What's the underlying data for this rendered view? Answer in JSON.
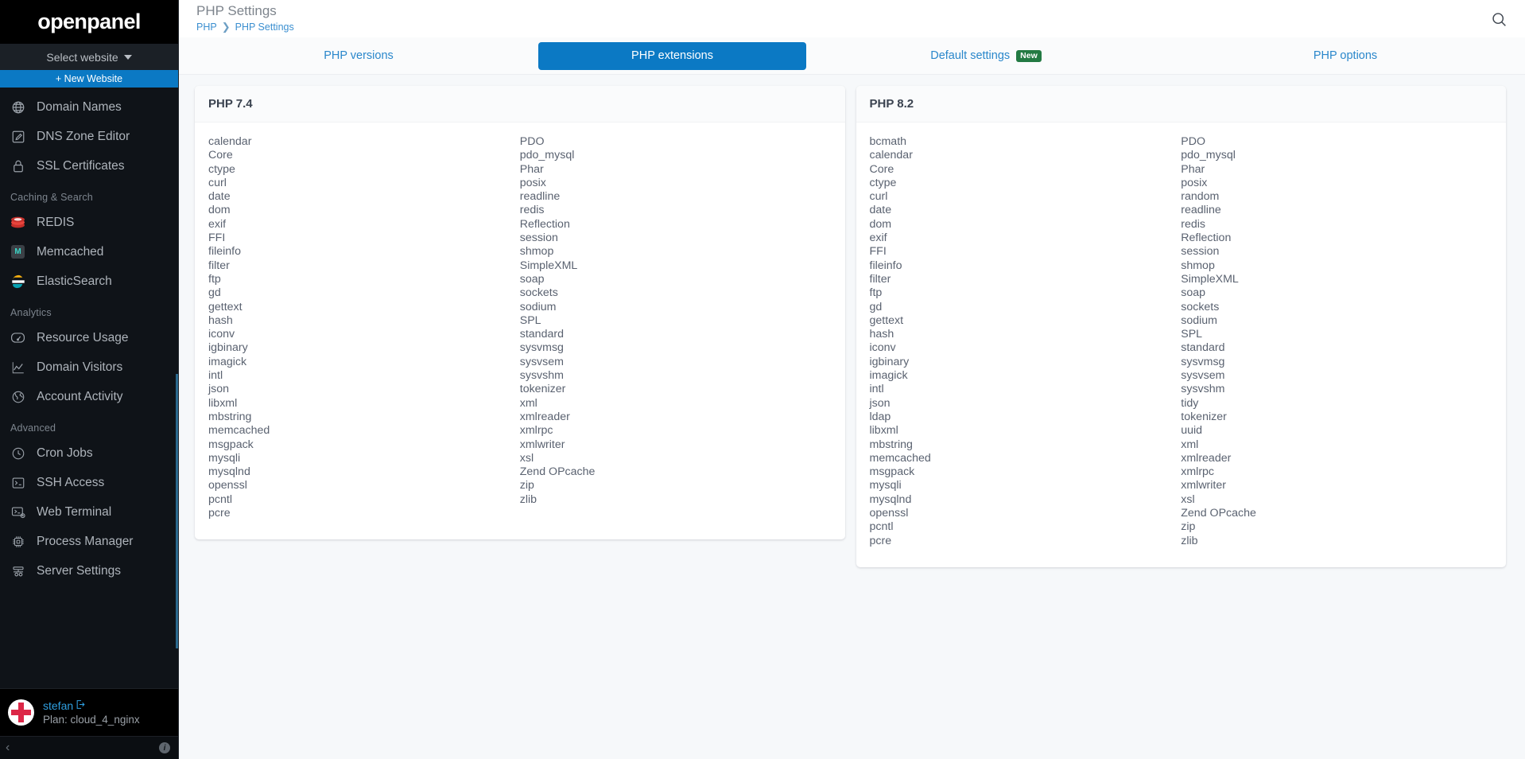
{
  "sidebar": {
    "brand": "openpanel",
    "site_select": "Select website",
    "new_website": "+ New Website",
    "top_items": [
      {
        "label": "Domain Names",
        "icon": "globe-icon"
      },
      {
        "label": "DNS Zone Editor",
        "icon": "edit-square-icon"
      },
      {
        "label": "SSL Certificates",
        "icon": "lock-icon"
      }
    ],
    "groups": [
      {
        "title": "Caching & Search",
        "items": [
          {
            "label": "REDIS",
            "icon": "redis-logo-icon"
          },
          {
            "label": "Memcached",
            "icon": "memcached-logo-icon"
          },
          {
            "label": "ElasticSearch",
            "icon": "elasticsearch-logo-icon"
          }
        ]
      },
      {
        "title": "Analytics",
        "items": [
          {
            "label": "Resource Usage",
            "icon": "gauge-icon"
          },
          {
            "label": "Domain Visitors",
            "icon": "line-chart-icon"
          },
          {
            "label": "Account Activity",
            "icon": "globe-activity-icon"
          }
        ]
      },
      {
        "title": "Advanced",
        "items": [
          {
            "label": "Cron Jobs",
            "icon": "clock-icon"
          },
          {
            "label": "SSH Access",
            "icon": "terminal-icon"
          },
          {
            "label": "Web Terminal",
            "icon": "web-terminal-icon"
          },
          {
            "label": "Process Manager",
            "icon": "cpu-icon"
          },
          {
            "label": "Server Settings",
            "icon": "server-settings-icon"
          }
        ]
      }
    ],
    "user": {
      "name": "stefan",
      "plan": "Plan: cloud_4_nginx"
    },
    "footer": {
      "collapse": "‹",
      "info": "i"
    }
  },
  "header": {
    "title": "PHP Settings",
    "breadcrumb": [
      "PHP",
      "PHP Settings"
    ],
    "breadcrumb_separator": "❯",
    "search_icon": "search-icon"
  },
  "tabs": [
    {
      "label": "PHP versions",
      "active": false,
      "badge": null
    },
    {
      "label": "PHP extensions",
      "active": true,
      "badge": null
    },
    {
      "label": "Default settings",
      "active": false,
      "badge": "New"
    },
    {
      "label": "PHP options",
      "active": false,
      "badge": null
    }
  ],
  "cards": [
    {
      "title": "PHP 7.4",
      "left": [
        "calendar",
        "Core",
        "ctype",
        "curl",
        "date",
        "dom",
        "exif",
        "FFI",
        "fileinfo",
        "filter",
        "ftp",
        "gd",
        "gettext",
        "hash",
        "iconv",
        "igbinary",
        "imagick",
        "intl",
        "json",
        "libxml",
        "mbstring",
        "memcached",
        "msgpack",
        "mysqli",
        "mysqlnd",
        "openssl",
        "pcntl",
        "pcre"
      ],
      "right": [
        "PDO",
        "pdo_mysql",
        "Phar",
        "posix",
        "readline",
        "redis",
        "Reflection",
        "session",
        "shmop",
        "SimpleXML",
        "soap",
        "sockets",
        "sodium",
        "SPL",
        "standard",
        "sysvmsg",
        "sysvsem",
        "sysvshm",
        "tokenizer",
        "xml",
        "xmlreader",
        "xmlrpc",
        "xmlwriter",
        "xsl",
        "Zend OPcache",
        "zip",
        "zlib"
      ]
    },
    {
      "title": "PHP 8.2",
      "left": [
        "bcmath",
        "calendar",
        "Core",
        "ctype",
        "curl",
        "date",
        "dom",
        "exif",
        "FFI",
        "fileinfo",
        "filter",
        "ftp",
        "gd",
        "gettext",
        "hash",
        "iconv",
        "igbinary",
        "imagick",
        "intl",
        "json",
        "ldap",
        "libxml",
        "mbstring",
        "memcached",
        "msgpack",
        "mysqli",
        "mysqlnd",
        "openssl",
        "pcntl",
        "pcre"
      ],
      "right": [
        "PDO",
        "pdo_mysql",
        "Phar",
        "posix",
        "random",
        "readline",
        "redis",
        "Reflection",
        "session",
        "shmop",
        "SimpleXML",
        "soap",
        "sockets",
        "sodium",
        "SPL",
        "standard",
        "sysvmsg",
        "sysvsem",
        "sysvshm",
        "tidy",
        "tokenizer",
        "uuid",
        "xml",
        "xmlreader",
        "xmlrpc",
        "xmlwriter",
        "xsl",
        "Zend OPcache",
        "zip",
        "zlib"
      ]
    }
  ],
  "colors": {
    "accent": "#0b79c4",
    "sidebar_bg": "#0f1318",
    "badge_green": "#237a43",
    "link": "#2a87cb"
  }
}
